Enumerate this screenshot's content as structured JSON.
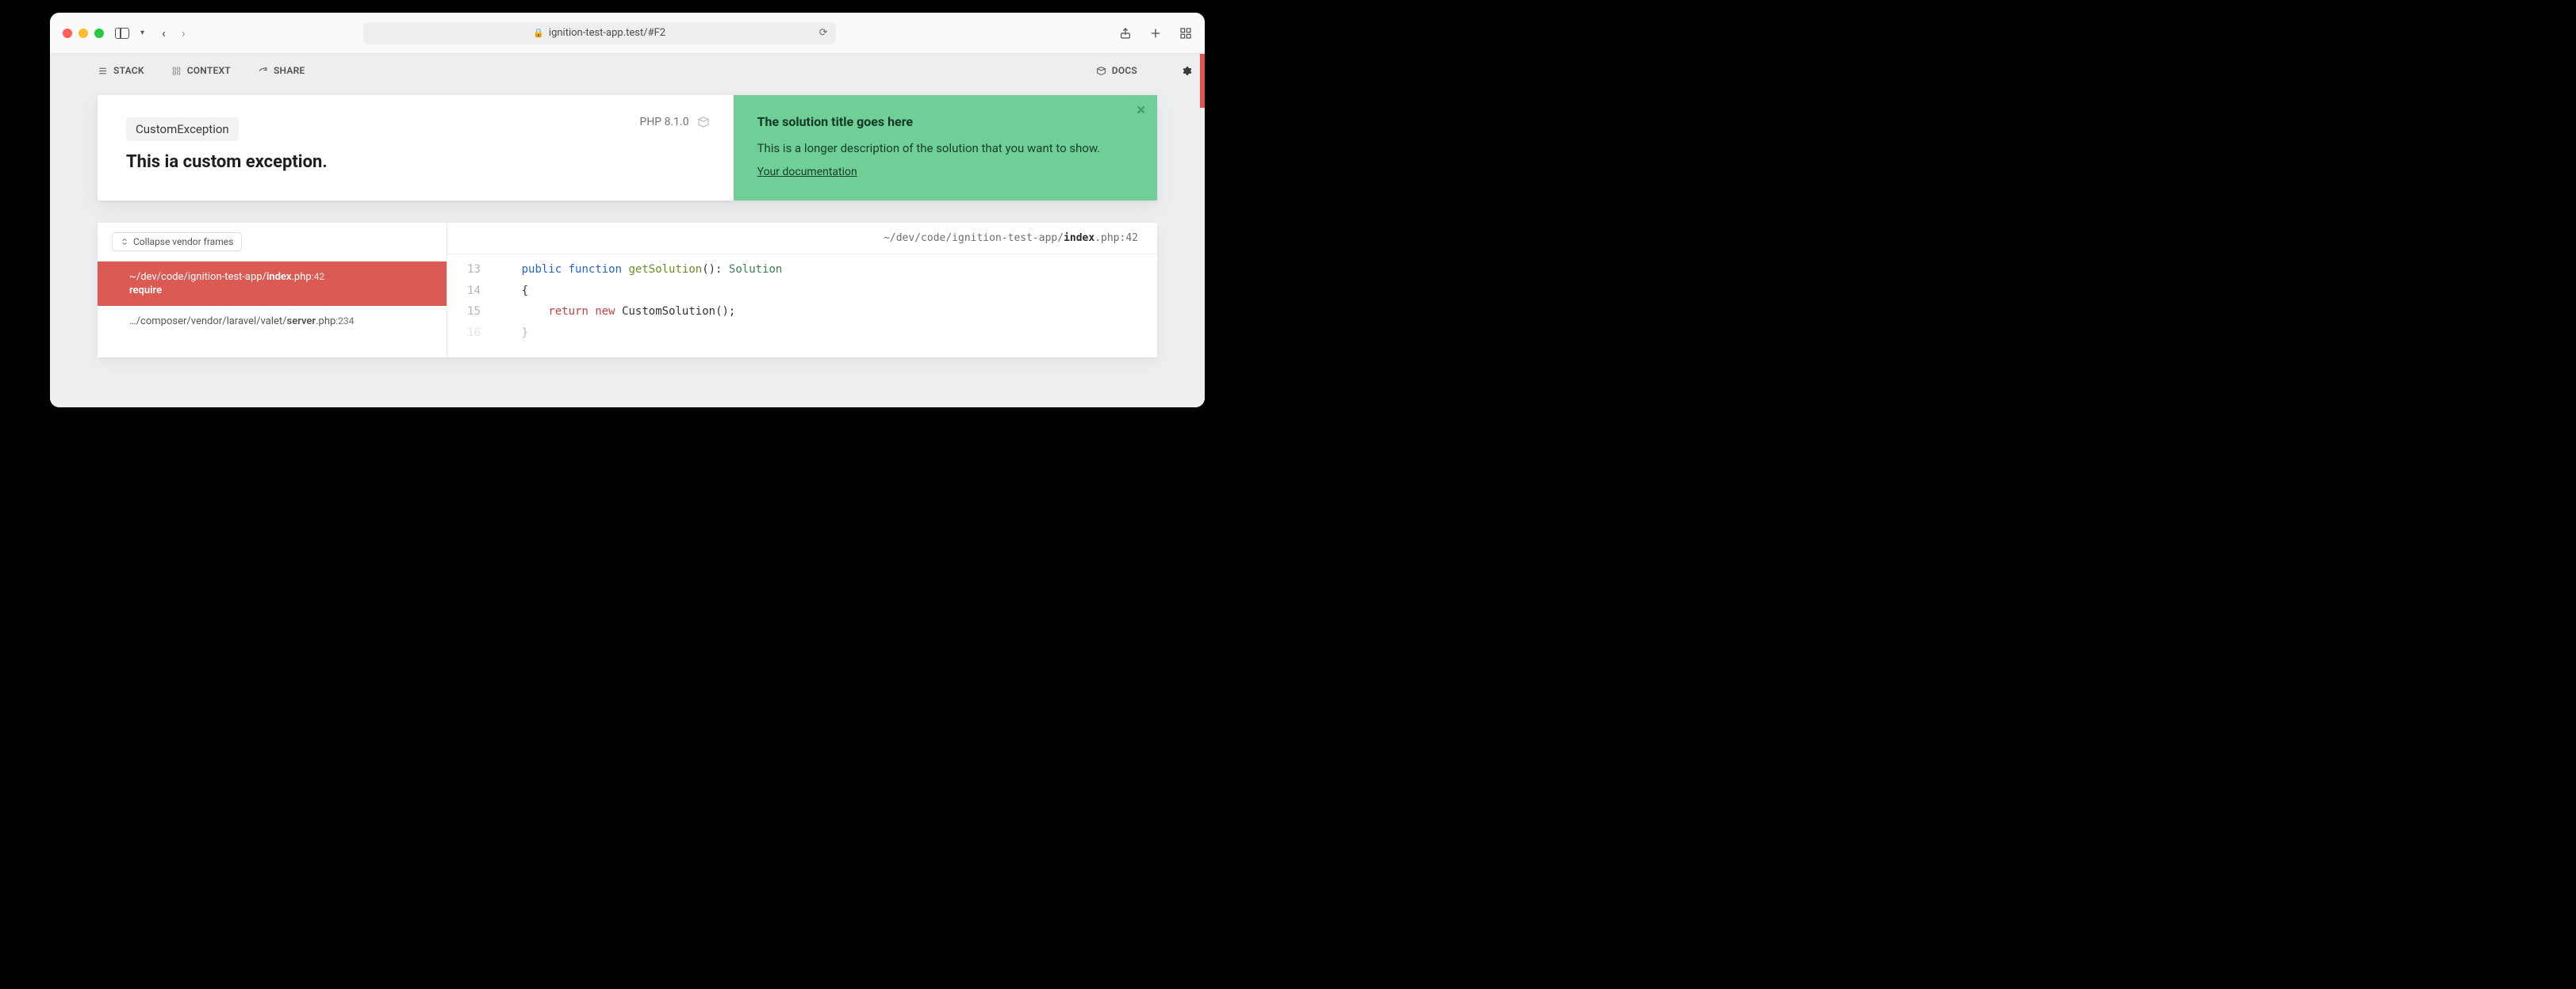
{
  "browser": {
    "url": "ignition-test-app.test/#F2"
  },
  "tabs": {
    "stack": "STACK",
    "context": "CONTEXT",
    "share": "SHARE",
    "docs": "DOCS"
  },
  "exception": {
    "class": "CustomException",
    "message": "This ia custom exception.",
    "php_version": "PHP 8.1.0"
  },
  "solution": {
    "title": "The solution title goes here",
    "description": "This is a longer description of the solution that you want to show.",
    "link_label": "Your documentation"
  },
  "frames": {
    "collapse_label": "Collapse vendor frames",
    "active": {
      "path_prefix": "~/dev/code/ignition-test-app/",
      "file": "index",
      "ext": ".php",
      "line": "42",
      "function": "require"
    },
    "next": {
      "path_prefix": "…/composer/vendor/laravel/valet/",
      "file": "server",
      "ext": ".php",
      "line": "234"
    }
  },
  "code": {
    "path_prefix": "~/dev/code/ignition-test-app/",
    "file": "index",
    "ext": ".php",
    "line": "42",
    "lines": {
      "l13": {
        "n": "13",
        "kw_vis": "public",
        "kw_fn": "function",
        "name": "getSolution",
        "sig1": "(): ",
        "type": "Solution"
      },
      "l14": {
        "n": "14",
        "brace": "{"
      },
      "l15": {
        "n": "15",
        "kw_ret": "return",
        "kw_new": "new",
        "call": "CustomSolution();"
      },
      "l16": {
        "n": "16",
        "brace": "}"
      }
    }
  }
}
